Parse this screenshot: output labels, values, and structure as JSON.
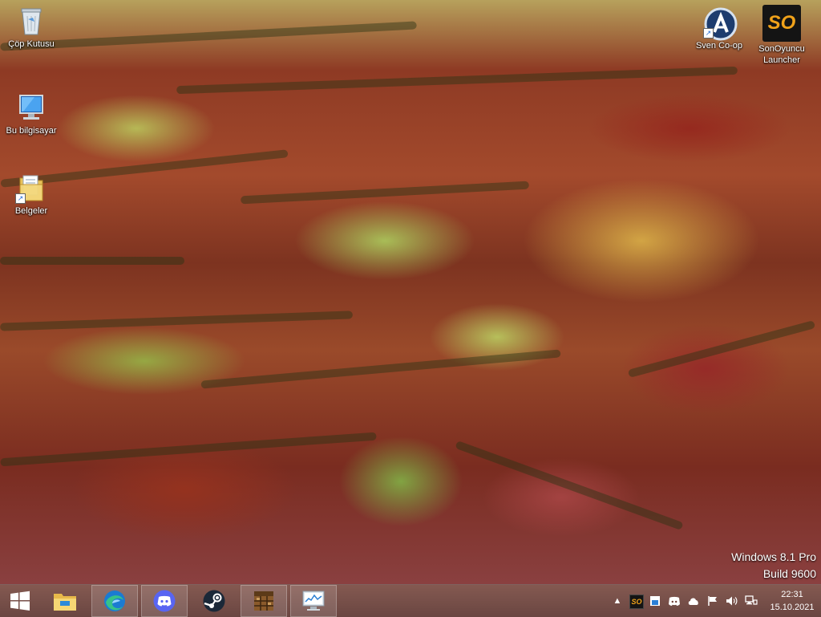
{
  "desktop_icons": [
    {
      "label": "Çöp Kutusu",
      "icon": "recycle-bin-icon"
    },
    {
      "label": "Bu bilgisayar",
      "icon": "computer-icon"
    },
    {
      "label": "Belgeler",
      "icon": "documents-folder-icon"
    },
    {
      "label": "Sven Co-op",
      "icon": "sven-coop-icon"
    },
    {
      "label": "SonOyuncu Launcher",
      "icon": "sonoyuncu-icon",
      "badge": "SO"
    }
  ],
  "watermark": {
    "line1": "Windows 8.1 Pro",
    "line2": "Build 9600"
  },
  "taskbar": {
    "start": "windows-start-icon",
    "pinned": [
      "file-explorer-icon",
      "edge-icon",
      "discord-icon",
      "steam-icon",
      "minecraft-icon",
      "resource-monitor-icon"
    ]
  },
  "tray": {
    "overflow": "chevron-up-icon",
    "sonoyuncu_badge": "SO",
    "icons": [
      "sonoyuncu-tray-icon",
      "app-tray-icon",
      "discord-tray-icon",
      "cloud-tray-icon",
      "cloud-tray-icon-2",
      "flag-icon",
      "volume-icon",
      "network-icon"
    ]
  },
  "clock": {
    "time": "22:31",
    "date": "15.10.2021"
  },
  "colors": {
    "taskbar": "#6e3c32",
    "accent": "#ffffff"
  }
}
